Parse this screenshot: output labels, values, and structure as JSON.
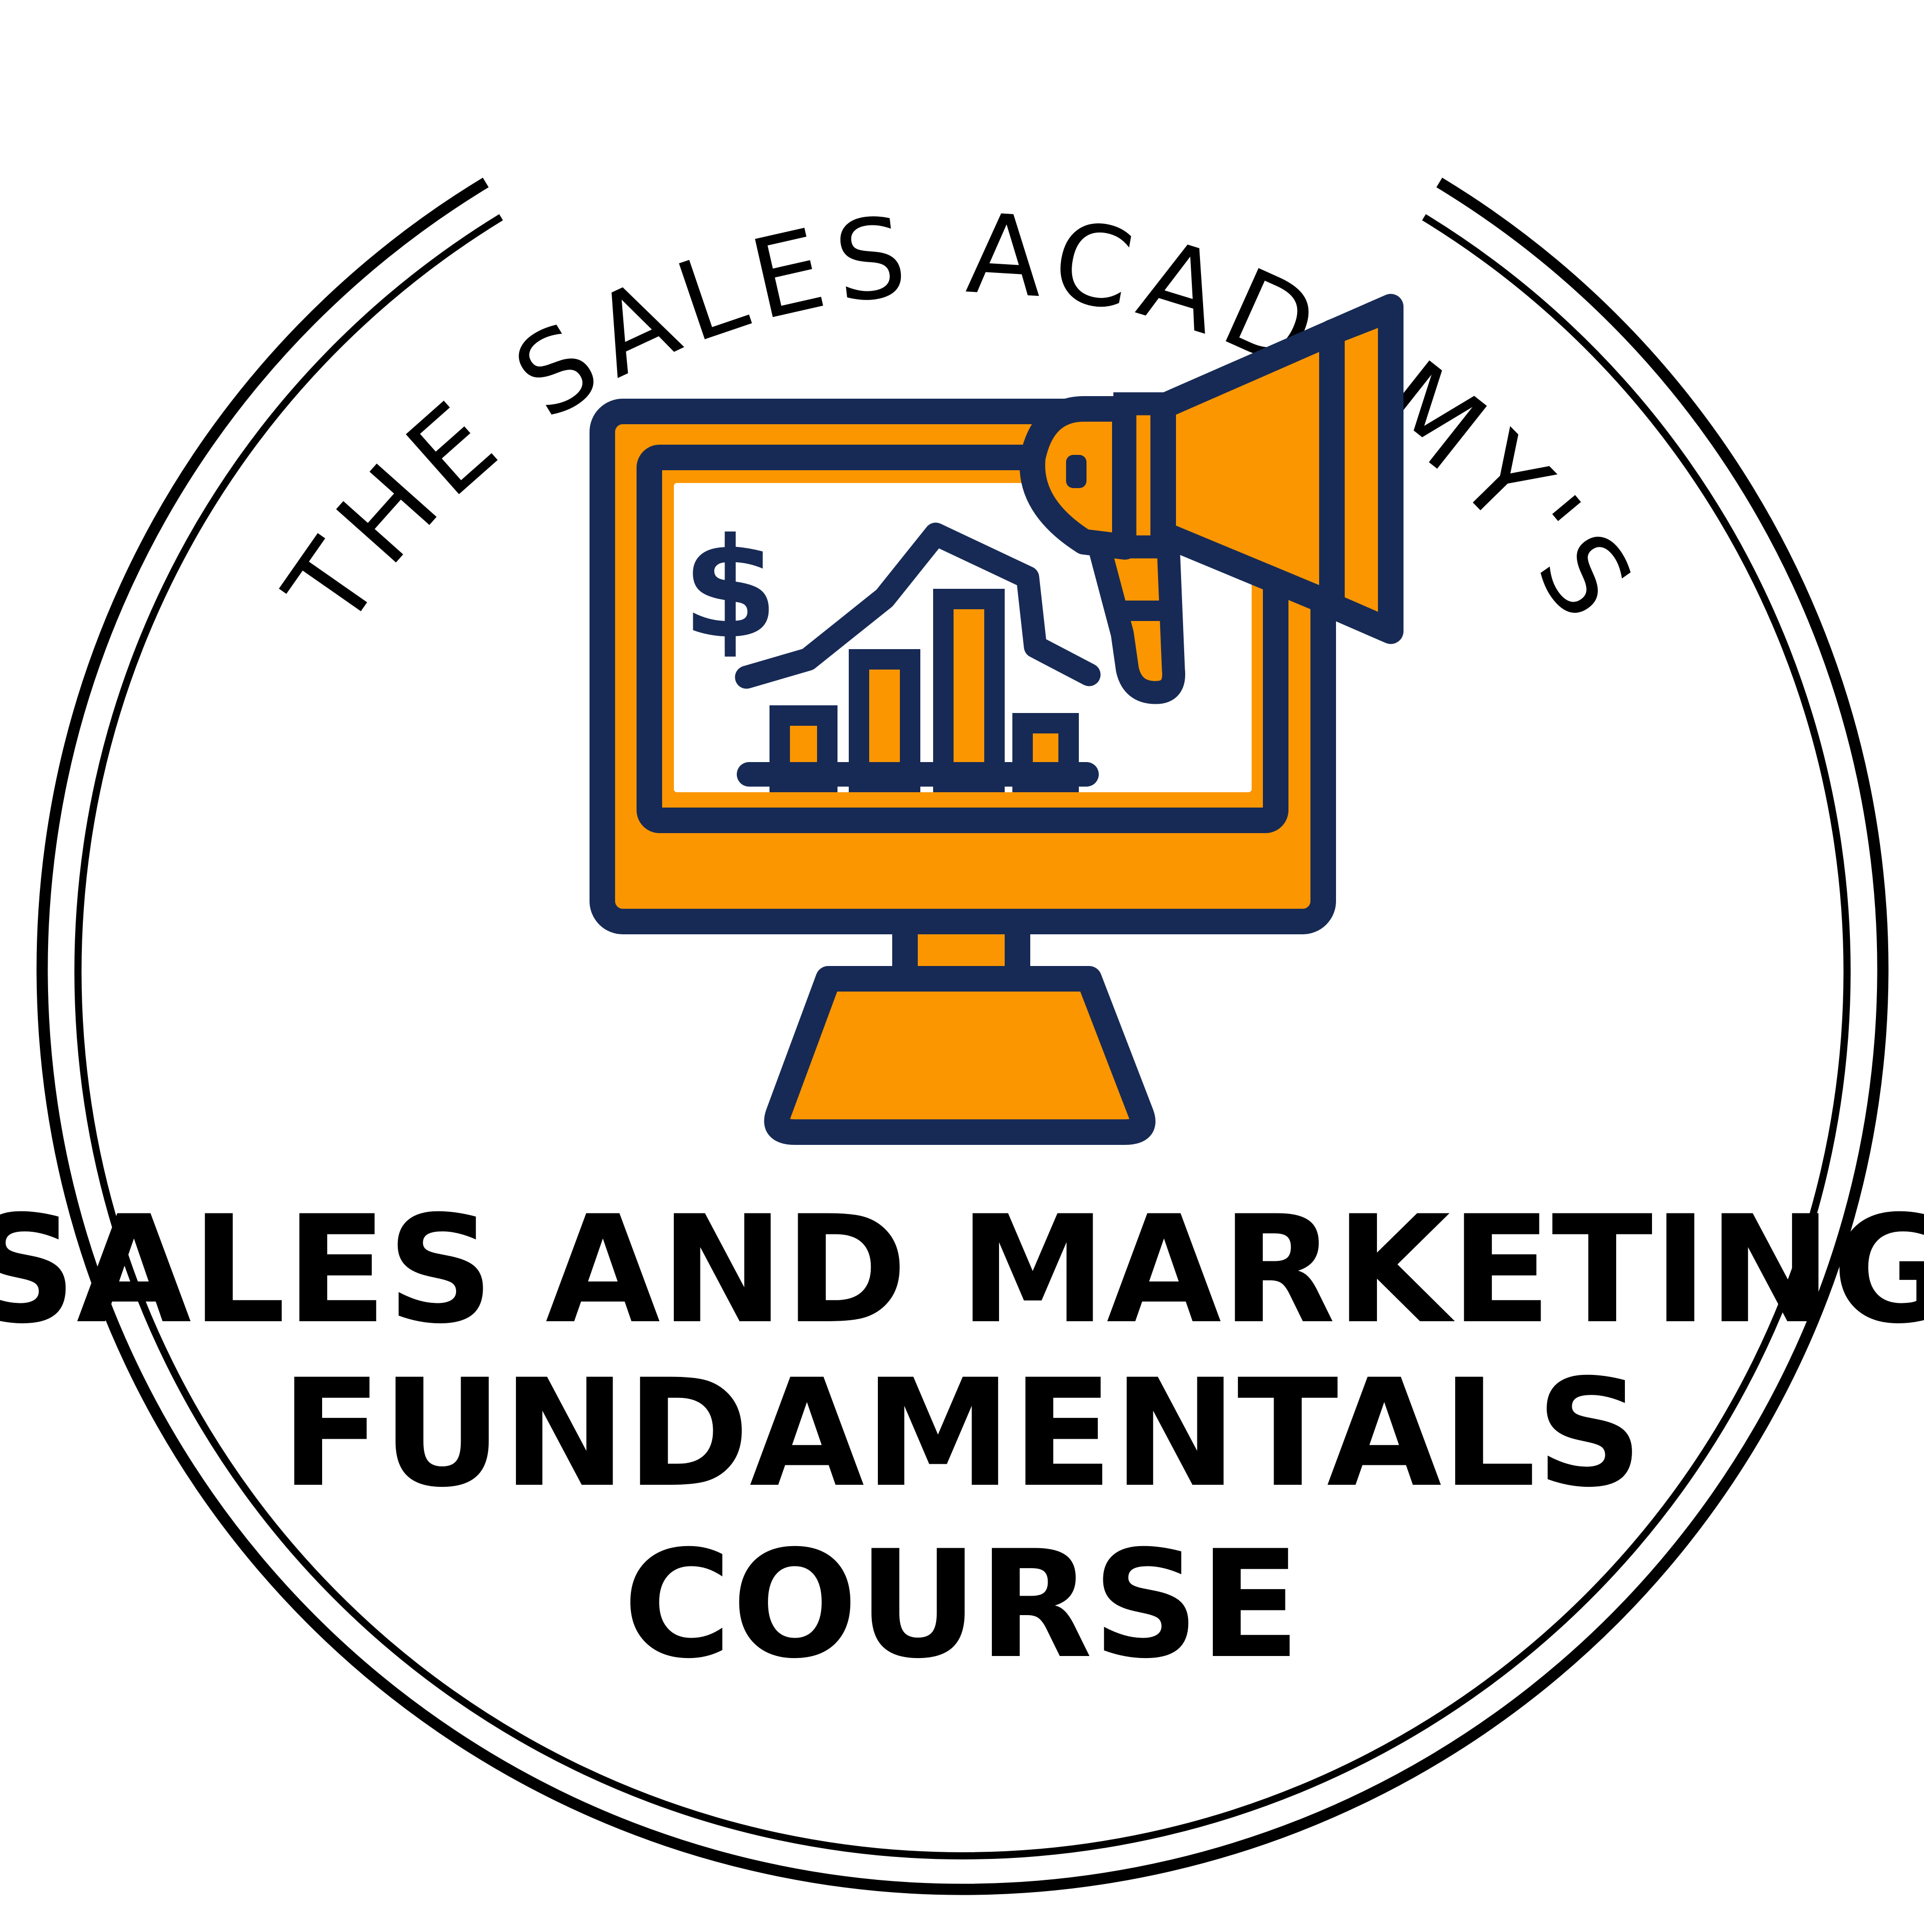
{
  "badge": {
    "arc_text": "THE SALES ACADEMY'S",
    "title_line_1": "SALES AND MARKETING",
    "title_line_2": "FUNDAMENTALS",
    "title_line_3": "COURSE"
  },
  "icon": {
    "name": "monitor-megaphone-chart-icon",
    "currency_symbol": "$"
  },
  "colors": {
    "navy": "#172a55",
    "orange": "#fb9600",
    "ring": "#000000",
    "background": "#ffffff"
  }
}
